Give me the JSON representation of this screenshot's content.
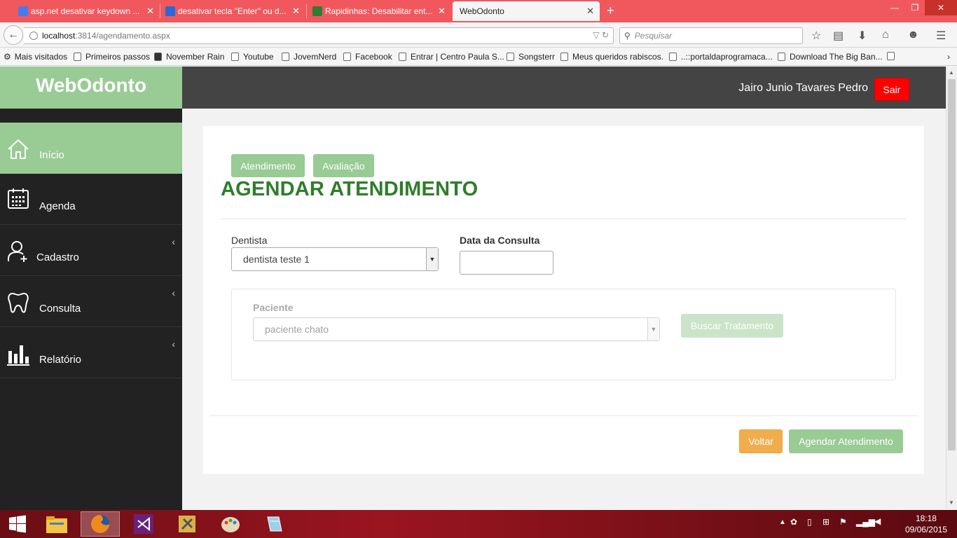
{
  "browser": {
    "tabs": [
      {
        "title": "asp.net desativar keydown ...",
        "favicon_color": "#4a7ae8"
      },
      {
        "title": "desativar tecla \"Enter\" ou d...",
        "favicon_color": "#2a6ad6"
      },
      {
        "title": "Rapidinhas: Desabilitar ent...",
        "favicon_color": "#2e7d32"
      },
      {
        "title": "WebOdonto",
        "favicon_color": ""
      }
    ],
    "url_host": "localhost",
    "url_path": ":3814/agendamento.aspx",
    "search_placeholder": "Pesquisar",
    "bookmarks": [
      "Mais visitados",
      "Primeiros passos",
      "November Rain",
      "Youtube",
      "JovemNerd",
      "Facebook",
      "Entrar | Centro Paula S...",
      "Songsterr",
      "Meus queridos rabiscos.",
      "..::portaldaprogramaca...",
      "Download The Big Ban..."
    ]
  },
  "app": {
    "brand": "WebOdonto",
    "user_name": "Jairo Junio Tavares Pedro",
    "logout_label": "Sair",
    "accent_color": "#99cb94",
    "title_color": "#2f7d2b",
    "sidebar": [
      {
        "label": "Início",
        "icon": "home-icon",
        "active": true
      },
      {
        "label": "Agenda",
        "icon": "calendar-icon",
        "active": false
      },
      {
        "label": "Cadastro",
        "icon": "add-user-icon",
        "active": false
      },
      {
        "label": "Consulta",
        "icon": "tooth-icon",
        "active": false
      },
      {
        "label": "Relatório",
        "icon": "bar-chart-icon",
        "active": false
      }
    ],
    "tabs": [
      "Atendimento",
      "Avaliação"
    ],
    "page_title": "AGENDAR ATENDIMENTO",
    "form": {
      "dentist_label": "Dentista",
      "dentist_value": "dentista teste 1",
      "date_label": "Data da Consulta",
      "date_value": "",
      "patient_label": "Paciente",
      "patient_value": "paciente chato",
      "search_treatment_label": "Buscar Tratamento"
    },
    "actions": {
      "back_label": "Voltar",
      "schedule_label": "Agendar Atendimento"
    }
  },
  "taskbar": {
    "time": "18:18",
    "date": "09/06/2015"
  }
}
